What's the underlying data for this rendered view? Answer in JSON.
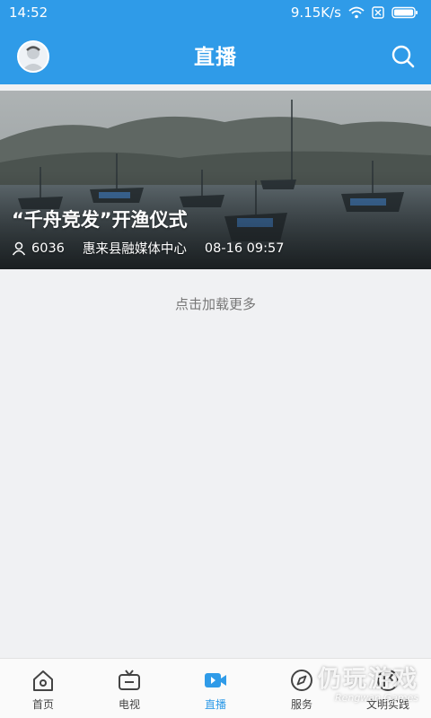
{
  "status_bar": {
    "time": "14:52",
    "net_speed": "9.15K/s"
  },
  "header": {
    "title": "直播"
  },
  "live_card": {
    "title": "“千舟竞发”开渔仪式",
    "viewers": "6036",
    "source": "惠来县融媒体中心",
    "datetime": "08-16 09:57"
  },
  "load_more": "点击加载更多",
  "tabs": [
    {
      "label": "首页",
      "icon": "home-icon"
    },
    {
      "label": "电视",
      "icon": "tv-icon"
    },
    {
      "label": "直播",
      "icon": "live-video-icon",
      "active": true
    },
    {
      "label": "服务",
      "icon": "compass-icon"
    },
    {
      "label": "文明实践",
      "icon": "flag-circle-icon"
    }
  ],
  "watermark": {
    "main": "仍玩游戏",
    "sub": "Rengwan Games"
  },
  "colors": {
    "primary": "#2f9be8",
    "background": "#f0f1f3"
  }
}
